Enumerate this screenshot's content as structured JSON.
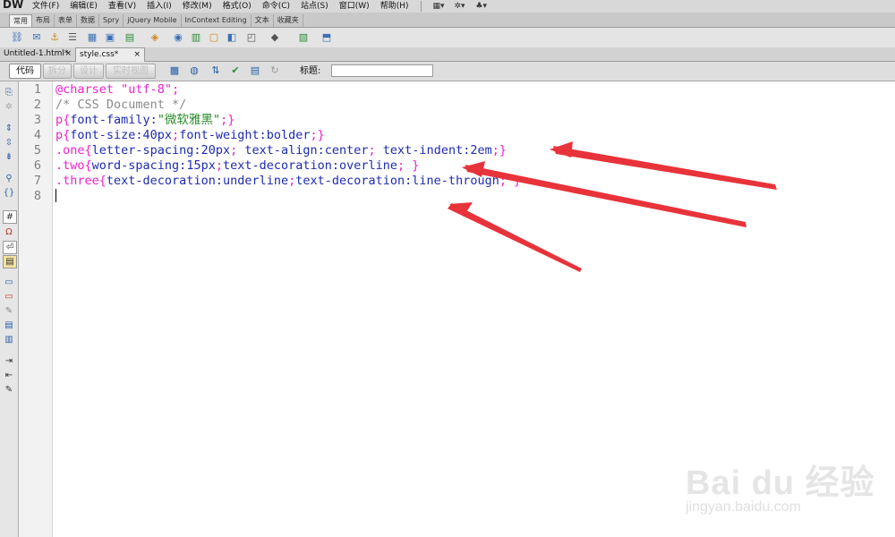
{
  "app": {
    "logo": "DW"
  },
  "menu": {
    "items": [
      "文件(F)",
      "编辑(E)",
      "查看(V)",
      "插入(I)",
      "修改(M)",
      "格式(O)",
      "命令(C)",
      "站点(S)",
      "窗口(W)",
      "帮助(H)"
    ],
    "icons": [
      "layout-icon",
      "gear-icon",
      "site-icon"
    ]
  },
  "insert_panel": {
    "tabs": [
      "常用",
      "布局",
      "表单",
      "数据",
      "Spry",
      "jQuery Mobile",
      "InContext Editing",
      "文本",
      "收藏夹"
    ],
    "active_tab": "常用"
  },
  "documents": {
    "tabs": [
      {
        "label": "Untitled-1.html*",
        "close": "×"
      },
      {
        "label": "style.css*",
        "close": "×",
        "active": true
      }
    ]
  },
  "doc_toolbar": {
    "view_buttons": [
      "代码",
      "拆分",
      "设计",
      "实时视图"
    ],
    "active_view": "代码",
    "title_label": "标题:",
    "title_value": ""
  },
  "editor": {
    "line_numbers": [
      "1",
      "2",
      "3",
      "4",
      "5",
      "6",
      "7",
      "8"
    ],
    "lines": [
      [
        {
          "t": "@charset ",
          "c": "c-at"
        },
        {
          "t": "\"utf-8\"",
          "c": "c-str"
        },
        {
          "t": ";",
          "c": "c-at"
        }
      ],
      [
        {
          "t": "/* CSS Document */",
          "c": "c-comment"
        }
      ],
      [
        {
          "t": "p{",
          "c": "c-sel"
        },
        {
          "t": "font-family:",
          "c": "c-prop"
        },
        {
          "t": "\"微软雅黑\"",
          "c": "c-cn"
        },
        {
          "t": ";}",
          "c": "c-brace"
        }
      ],
      [
        {
          "t": "p{",
          "c": "c-sel"
        },
        {
          "t": "font-size:",
          "c": "c-prop"
        },
        {
          "t": "40px",
          "c": "c-val"
        },
        {
          "t": ";",
          "c": "c-brace"
        },
        {
          "t": "font-weight:",
          "c": "c-prop"
        },
        {
          "t": "bolder",
          "c": "c-val"
        },
        {
          "t": ";}",
          "c": "c-brace"
        }
      ],
      [
        {
          "t": ".one{",
          "c": "c-sel"
        },
        {
          "t": "letter-spacing:",
          "c": "c-prop"
        },
        {
          "t": "20px",
          "c": "c-val"
        },
        {
          "t": "; ",
          "c": "c-brace"
        },
        {
          "t": "text-align:",
          "c": "c-prop"
        },
        {
          "t": "center",
          "c": "c-val"
        },
        {
          "t": "; ",
          "c": "c-brace"
        },
        {
          "t": "text-indent:",
          "c": "c-prop"
        },
        {
          "t": "2em",
          "c": "c-val"
        },
        {
          "t": ";}",
          "c": "c-brace"
        }
      ],
      [
        {
          "t": ".two{",
          "c": "c-sel"
        },
        {
          "t": "word-spacing:",
          "c": "c-prop"
        },
        {
          "t": "15px",
          "c": "c-val"
        },
        {
          "t": ";",
          "c": "c-brace"
        },
        {
          "t": "text-decoration:",
          "c": "c-prop"
        },
        {
          "t": "overline",
          "c": "c-val"
        },
        {
          "t": "; }",
          "c": "c-brace"
        }
      ],
      [
        {
          "t": ".three{",
          "c": "c-sel"
        },
        {
          "t": "text-decoration:",
          "c": "c-prop"
        },
        {
          "t": "underline",
          "c": "c-val"
        },
        {
          "t": ";",
          "c": "c-brace"
        },
        {
          "t": "text-decoration:",
          "c": "c-prop"
        },
        {
          "t": "line-through",
          "c": "c-val"
        },
        {
          "t": "; }",
          "c": "c-brace"
        }
      ],
      []
    ]
  },
  "colors": {
    "annotation_arrow": "#e8333a"
  },
  "watermark": {
    "main": "Bai du 经验",
    "sub": "jingyan.baidu.com"
  }
}
